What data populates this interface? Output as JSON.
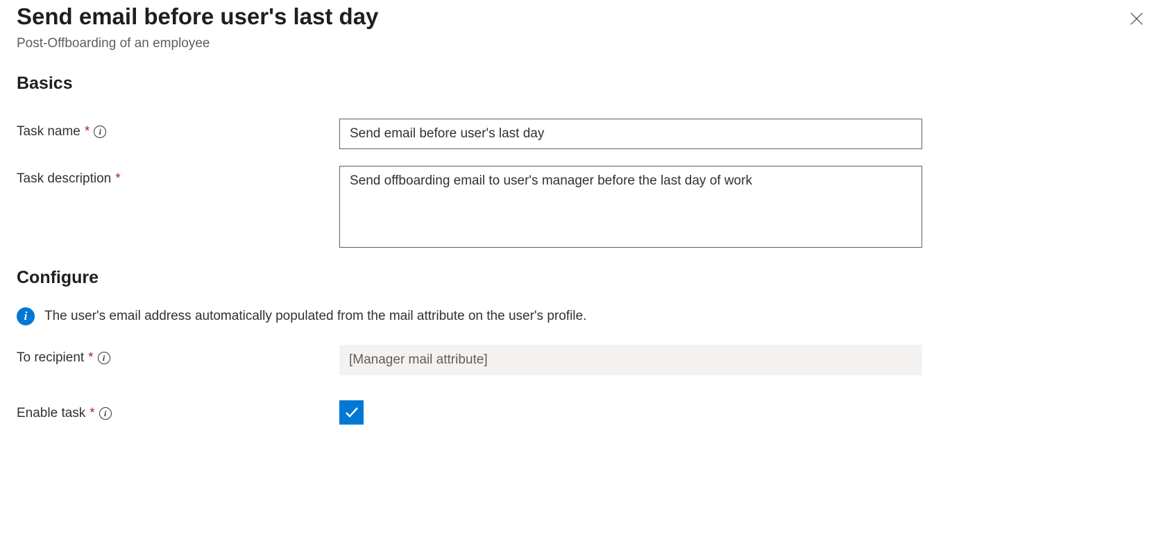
{
  "header": {
    "title": "Send email before user's last day",
    "subtitle": "Post-Offboarding of an employee"
  },
  "sections": {
    "basics": "Basics",
    "configure": "Configure"
  },
  "basics": {
    "task_name_label": "Task name",
    "task_name_value": "Send email before user's last day",
    "task_description_label": "Task description",
    "task_description_value": "Send offboarding email to user's manager before the last day of work"
  },
  "configure": {
    "info_message": "The user's email address automatically populated from the mail attribute on the user's profile.",
    "to_recipient_label": "To recipient",
    "to_recipient_value": "[Manager mail attribute]",
    "enable_task_label": "Enable task"
  }
}
